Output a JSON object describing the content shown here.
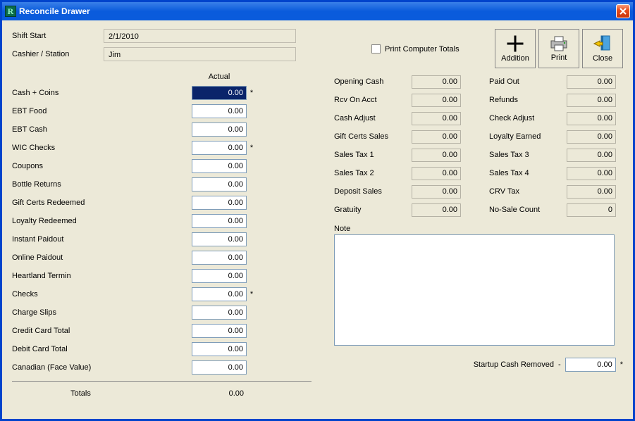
{
  "window": {
    "title": "Reconcile Drawer"
  },
  "header": {
    "shift_start_label": "Shift Start",
    "shift_start_value": "2/1/2010",
    "cashier_label": "Cashier / Station",
    "cashier_value": "Jim",
    "print_totals_label": "Print Computer Totals"
  },
  "toolbar": {
    "addition": "Addition",
    "print": "Print",
    "close": "Close"
  },
  "actual": {
    "header": "Actual",
    "rows": [
      {
        "label": "Cash + Coins",
        "value": "0.00",
        "star": true,
        "selected": true
      },
      {
        "label": "EBT Food",
        "value": "0.00",
        "star": false,
        "selected": false
      },
      {
        "label": "EBT Cash",
        "value": "0.00",
        "star": false,
        "selected": false
      },
      {
        "label": "WIC Checks",
        "value": "0.00",
        "star": true,
        "selected": false
      },
      {
        "label": "Coupons",
        "value": "0.00",
        "star": false,
        "selected": false
      },
      {
        "label": "Bottle Returns",
        "value": "0.00",
        "star": false,
        "selected": false
      },
      {
        "label": "Gift Certs Redeemed",
        "value": "0.00",
        "star": false,
        "selected": false
      },
      {
        "label": "Loyalty Redeemed",
        "value": "0.00",
        "star": false,
        "selected": false
      },
      {
        "label": "Instant Paidout",
        "value": "0.00",
        "star": false,
        "selected": false
      },
      {
        "label": "Online Paidout",
        "value": "0.00",
        "star": false,
        "selected": false
      },
      {
        "label": "Heartland Termin",
        "value": "0.00",
        "star": false,
        "selected": false
      },
      {
        "label": "Checks",
        "value": "0.00",
        "star": true,
        "selected": false
      },
      {
        "label": "Charge Slips",
        "value": "0.00",
        "star": false,
        "selected": false
      },
      {
        "label": "Credit Card Total",
        "value": "0.00",
        "star": false,
        "selected": false
      },
      {
        "label": "Debit Card Total",
        "value": "0.00",
        "star": false,
        "selected": false
      },
      {
        "label": "Canadian (Face Value)",
        "value": "0.00",
        "star": false,
        "selected": false
      }
    ],
    "totals_label": "Totals",
    "totals_value": "0.00"
  },
  "summary": {
    "col1": [
      {
        "label": "Opening Cash",
        "value": "0.00"
      },
      {
        "label": "Rcv On Acct",
        "value": "0.00"
      },
      {
        "label": "Cash Adjust",
        "value": "0.00"
      },
      {
        "label": "Gift Certs Sales",
        "value": "0.00"
      },
      {
        "label": "Sales Tax 1",
        "value": "0.00"
      },
      {
        "label": "Sales Tax 2",
        "value": "0.00"
      },
      {
        "label": "Deposit Sales",
        "value": "0.00"
      },
      {
        "label": "Gratuity",
        "value": "0.00"
      }
    ],
    "col2": [
      {
        "label": "Paid Out",
        "value": "0.00"
      },
      {
        "label": "Refunds",
        "value": "0.00"
      },
      {
        "label": "Check Adjust",
        "value": "0.00"
      },
      {
        "label": "Loyalty Earned",
        "value": "0.00"
      },
      {
        "label": "Sales Tax 3",
        "value": "0.00"
      },
      {
        "label": "Sales Tax 4",
        "value": "0.00"
      },
      {
        "label": "CRV Tax",
        "value": "0.00"
      },
      {
        "label": "No-Sale Count",
        "value": "0"
      }
    ]
  },
  "note": {
    "label": "Note",
    "value": ""
  },
  "startup": {
    "label": "Startup Cash Removed",
    "minus": "-",
    "value": "0.00",
    "star": "*"
  }
}
